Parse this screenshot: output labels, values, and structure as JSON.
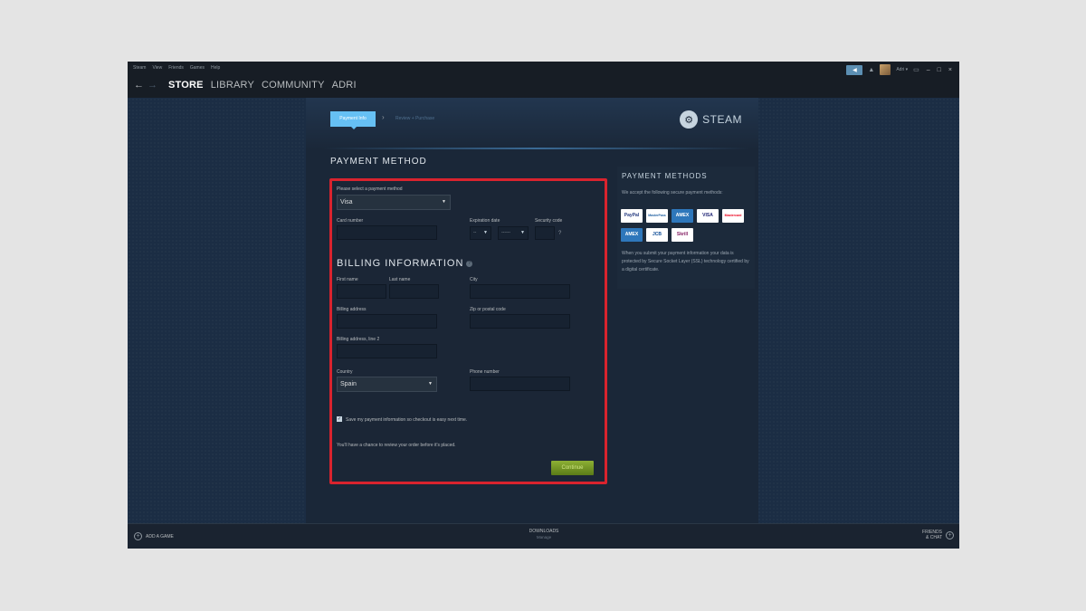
{
  "menu": [
    "Steam",
    "View",
    "Friends",
    "Games",
    "Help"
  ],
  "nav": {
    "back_icon": "arrow-left-icon",
    "forward_icon": "arrow-right-icon",
    "links": [
      "STORE",
      "LIBRARY",
      "COMMUNITY",
      "ADRI"
    ]
  },
  "topright": {
    "username": "Adri ▾"
  },
  "steps": {
    "active": "Payment Info",
    "next": "Review + Purchase"
  },
  "brand": {
    "name": "STEAM"
  },
  "payment": {
    "title": "PAYMENT METHOD",
    "select_label": "Please select a payment method",
    "method": "Visa",
    "card_label": "Card number",
    "expiry_label": "Expiration date",
    "month_value": "--",
    "year_value": "------",
    "security_label": "Security code",
    "help_symbol": "?"
  },
  "billing": {
    "title": "BILLING INFORMATION",
    "first_name": "First name",
    "last_name": "Last name",
    "city": "City",
    "address": "Billing address",
    "zip": "Zip or postal code",
    "address2": "Billing address, line 2",
    "country_label": "Country",
    "country": "Spain",
    "phone": "Phone number",
    "save_label": "Save my payment information so checkout is easy next time.",
    "review_note": "You'll have a chance to review your order before it's placed.",
    "continue": "Continue"
  },
  "methods": {
    "title": "PAYMENT METHODS",
    "intro": "We accept the following secure payment methods:",
    "cards": [
      "PayPal",
      "MasterPass",
      "AMEX",
      "VISA",
      "Mastercard",
      "AMEX",
      "JCB",
      "Skrill"
    ],
    "security": "When you submit your payment information your data is protected by Secure Socket Layer (SSL) technology certified by a digital certificate."
  },
  "footer": {
    "add_game": "ADD A GAME",
    "downloads": "DOWNLOADS",
    "manage": "Manage",
    "friends": "FRIENDS & CHAT"
  },
  "colors": {
    "accent": "#66c0f4",
    "highlight": "#d9232e",
    "continue": "#8db035"
  }
}
